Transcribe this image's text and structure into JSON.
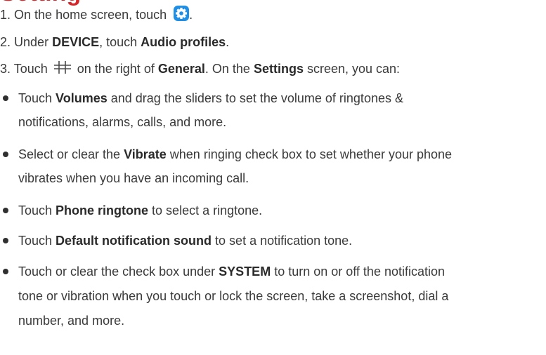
{
  "heading_fragment": "Setting",
  "steps": [
    {
      "num": "1.",
      "text_before": "On the home screen, touch",
      "icon": "settings-gear-icon",
      "text_after": "."
    },
    {
      "num": "2.",
      "text_before": "Under",
      "bold1": "DEVICE",
      "text_mid": ", touch",
      "bold2": "Audio profiles",
      "text_after": "."
    },
    {
      "num": "3.",
      "text_before": "Touch",
      "icon": "equalizer-sliders-icon",
      "text_mid1": "on the right of",
      "bold1": "General",
      "text_mid2": ". On the",
      "bold2": "Settings",
      "text_after": "screen, you can:"
    }
  ],
  "bullets": [
    {
      "lines": [
        {
          "pre": "Touch ",
          "bold": "Volumes",
          "post": " and drag the sliders to set the volume of ringtones &"
        },
        {
          "text": "notifications, alarms, calls, and more."
        }
      ]
    },
    {
      "lines": [
        {
          "pre": "Select or clear the ",
          "bold": "Vibrate",
          "post": " when ringing check box to set whether your phone"
        },
        {
          "text": "vibrates when you have an incoming call."
        }
      ]
    },
    {
      "lines": [
        {
          "pre": "Touch ",
          "bold": "Phone ringtone",
          "post": " to select a ringtone."
        }
      ]
    },
    {
      "lines": [
        {
          "pre": "Touch ",
          "bold": "Default notification sound",
          "post": " to set a notification tone."
        }
      ]
    },
    {
      "lines": [
        {
          "pre": "Touch or clear the check box under ",
          "bold": "SYSTEM",
          "post": " to turn on or off the notification"
        },
        {
          "text": "tone or vibration when you touch or lock the screen, take a screenshot, dial a"
        },
        {
          "text": "number, and more."
        }
      ]
    }
  ],
  "colors": {
    "heading": "#d7262a",
    "icon_blue": "#1f8fe6",
    "text": "#3a3a3a"
  }
}
